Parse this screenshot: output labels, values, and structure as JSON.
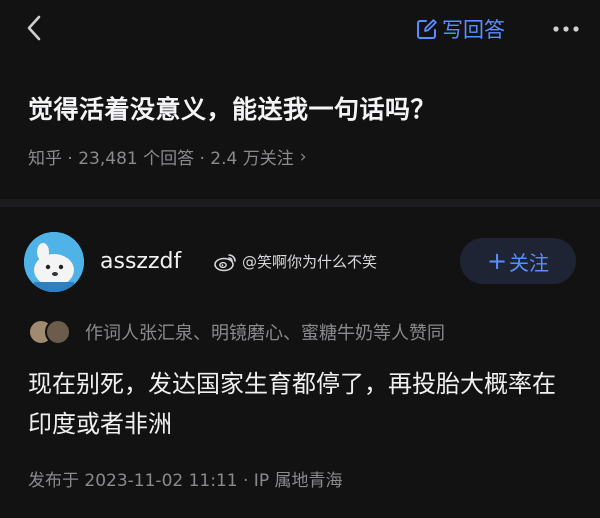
{
  "topbar": {
    "back_icon": "chevron-left-icon",
    "write_icon": "edit-icon",
    "write_label": "写回答",
    "more_icon": "more-horizontal-icon",
    "accent_color": "#5a8dff"
  },
  "question": {
    "title": "觉得活着没意义，能送我一句话吗？",
    "meta": "知乎 · 23,481 个回答 · 2.4 万关注",
    "meta_chevron": "›"
  },
  "answer": {
    "author_name": "asszzdf",
    "weibo_icon": "weibo-icon",
    "weibo_handle": "@笑啊你为什么不笑",
    "follow_plus": "+",
    "follow_label": "关注",
    "upvoters_text": "作词人张汇泉、明镜磨心、蜜糖牛奶等人赞同",
    "content": "现在别死，发达国家生育都停了，再投胎大概率在印度或者非洲",
    "published": "发布于 2023-11-02 11:11 · IP 属地青海"
  }
}
